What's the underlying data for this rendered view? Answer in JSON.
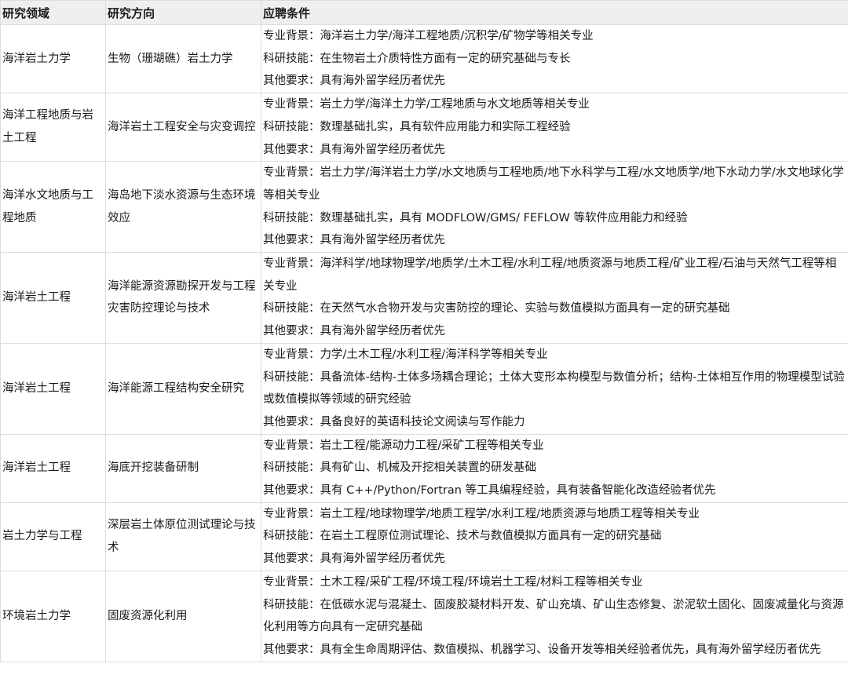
{
  "headers": [
    "研究领域",
    "研究方向",
    "应聘条件"
  ],
  "rows": [
    {
      "field": "海洋岩土力学",
      "direction": "生物（珊瑚礁）岩土力学",
      "requirements": [
        "专业背景：海洋岩土力学/海洋工程地质/沉积学/矿物学等相关专业",
        "科研技能：在生物岩土介质特性方面有一定的研究基础与专长",
        "其他要求：具有海外留学经历者优先"
      ]
    },
    {
      "field": "海洋工程地质与岩土工程",
      "direction": "海洋岩土工程安全与灾变调控",
      "requirements": [
        "专业背景：岩土力学/海洋土力学/工程地质与水文地质等相关专业",
        "科研技能：数理基础扎实，具有软件应用能力和实际工程经验",
        "其他要求：具有海外留学经历者优先"
      ]
    },
    {
      "field": "海洋水文地质与工程地质",
      "direction": "海岛地下淡水资源与生态环境效应",
      "requirements": [
        "专业背景：岩土力学/海洋岩土力学/水文地质与工程地质/地下水科学与工程/水文地质学/地下水动力学/水文地球化学等相关专业",
        "科研技能：数理基础扎实，具有 MODFLOW/GMS/ FEFLOW 等软件应用能力和经验",
        "其他要求：具有海外留学经历者优先"
      ]
    },
    {
      "field": "海洋岩土工程",
      "direction": "海洋能源资源勘探开发与工程灾害防控理论与技术",
      "requirements": [
        "专业背景：海洋科学/地球物理学/地质学/土木工程/水利工程/地质资源与地质工程/矿业工程/石油与天然气工程等相关专业",
        "科研技能：在天然气水合物开发与灾害防控的理论、实验与数值模拟方面具有一定的研究基础",
        "其他要求：具有海外留学经历者优先"
      ]
    },
    {
      "field": "海洋岩土工程",
      "direction": "海洋能源工程结构安全研究",
      "requirements": [
        "专业背景：力学/土木工程/水利工程/海洋科学等相关专业",
        "科研技能：具备流体-结构-土体多场耦合理论；土体大变形本构模型与数值分析；结构-土体相互作用的物理模型试验或数值模拟等领域的研究经验",
        "其他要求：具备良好的英语科技论文阅读与写作能力"
      ]
    },
    {
      "field": "海洋岩土工程",
      "direction": "海底开挖装备研制",
      "requirements": [
        "专业背景：岩土工程/能源动力工程/采矿工程等相关专业",
        "科研技能：具有矿山、机械及开挖相关装置的研发基础",
        "其他要求：具有 C++/Python/Fortran 等工具编程经验，具有装备智能化改造经验者优先"
      ]
    },
    {
      "field": "岩土力学与工程",
      "direction": "深层岩土体原位测试理论与技术",
      "requirements": [
        "专业背景：岩土工程/地球物理学/地质工程学/水利工程/地质资源与地质工程等相关专业",
        "科研技能：在岩土工程原位测试理论、技术与数值模拟方面具有一定的研究基础",
        "其他要求：具有海外留学经历者优先"
      ]
    },
    {
      "field": "环境岩土力学",
      "direction": "固废资源化利用",
      "requirements": [
        "专业背景：土木工程/采矿工程/环境工程/环境岩土工程/材料工程等相关专业",
        "科研技能：在低碳水泥与混凝土、固废胶凝材料开发、矿山充填、矿山生态修复、淤泥软土固化、固废减量化与资源化利用等方向具有一定研究基础",
        "其他要求：具有全生命周期评估、数值模拟、机器学习、设备开发等相关经验者优先，具有海外留学经历者优先"
      ]
    }
  ]
}
